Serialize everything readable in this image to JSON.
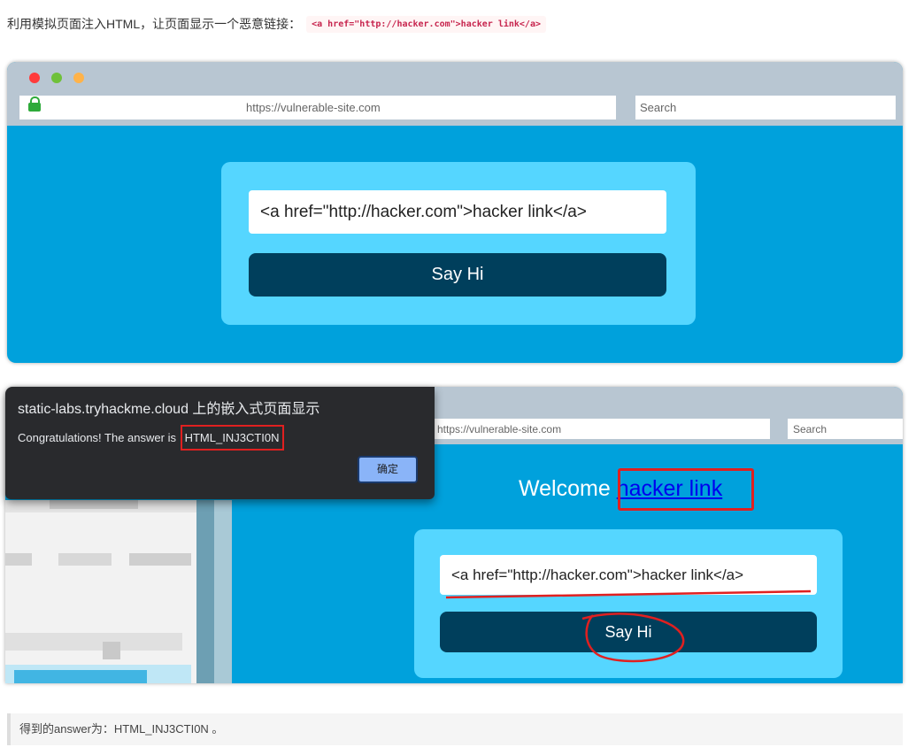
{
  "intro": {
    "text": "利用模拟页面注入HTML，让页面显示一个恶意链接：",
    "code": "<a href=\"http://hacker.com\">hacker link</a>"
  },
  "browser_top": {
    "url": "https://vulnerable-site.com",
    "search_placeholder": "Search",
    "input_value": "<a href=\"http://hacker.com\">hacker link</a>",
    "button_label": "Say Hi"
  },
  "browser_bottom": {
    "url": "https://vulnerable-site.com",
    "search_placeholder": "Search",
    "welcome_text": "Welcome",
    "link_text": "hacker link",
    "input_value": "<a href=\"http://hacker.com\">hacker link</a>",
    "button_label": "Say Hi"
  },
  "dialog": {
    "title": "static-labs.tryhackme.cloud 上的嵌入式页面显示",
    "message": "Congratulations! The answer is",
    "answer": "HTML_INJ3CTI0N",
    "ok_label": "确定"
  },
  "footer": {
    "text": "得到的answer为：HTML_INJ3CTI0N 。"
  },
  "colors": {
    "page_bg": "#00a1dc",
    "card_bg": "#55d6ff",
    "button_bg": "#003f5c",
    "browser_chrome": "#b8c6d2",
    "highlight_red": "#e02020"
  }
}
